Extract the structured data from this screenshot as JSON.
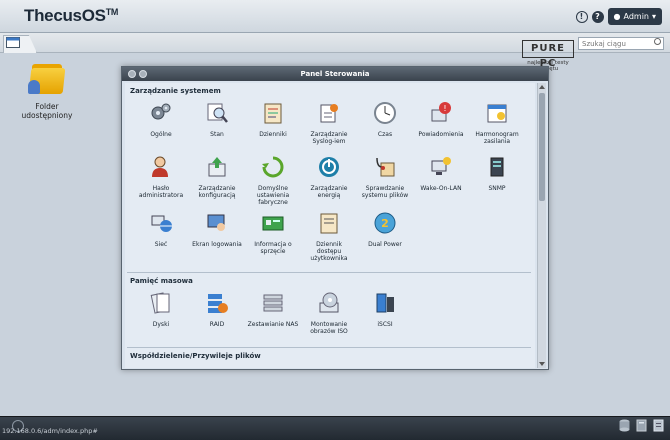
{
  "header": {
    "logo_main": "ThecusOS",
    "logo_tm": "TM",
    "info_icon": "info-icon",
    "help_icon": "help-icon",
    "user_label": "Admin"
  },
  "subbar": {
    "search_placeholder": "Szukaj ciągu"
  },
  "watermark": {
    "logo": "PURE PC",
    "tagline": "najlepsze testy sprzętu"
  },
  "desktop": {
    "folder_label": "Folder udostępniony"
  },
  "panel": {
    "title": "Panel Sterowania",
    "sections": [
      {
        "name": "Zarządzanie systemem",
        "items": [
          {
            "label": "Ogólne",
            "icon": "gears-icon"
          },
          {
            "label": "Stan",
            "icon": "magnifier-icon"
          },
          {
            "label": "Dzienniki",
            "icon": "log-icon"
          },
          {
            "label": "Zarządzanie Syslog-iem",
            "icon": "syslog-icon"
          },
          {
            "label": "Czas",
            "icon": "clock-icon"
          },
          {
            "label": "Powiadomienia",
            "icon": "notification-icon"
          },
          {
            "label": "Harmonogram zasilania",
            "icon": "schedule-icon"
          },
          {
            "label": "Hasło administratora",
            "icon": "admin-icon"
          },
          {
            "label": "Zarządzanie konfiguracją",
            "icon": "config-icon"
          },
          {
            "label": "Domyślne ustawienia fabryczne",
            "icon": "reset-icon"
          },
          {
            "label": "Zarządzanie energią",
            "icon": "power-icon"
          },
          {
            "label": "Sprawdzanie systemu plików",
            "icon": "stethoscope-icon"
          },
          {
            "label": "Wake-On-LAN",
            "icon": "wol-icon"
          },
          {
            "label": "SNMP",
            "icon": "snmp-icon"
          },
          {
            "label": "Sieć",
            "icon": "network-icon"
          },
          {
            "label": "Ekran logowania",
            "icon": "login-screen-icon"
          },
          {
            "label": "Informacja o sprzęcie",
            "icon": "hardware-info-icon"
          },
          {
            "label": "Dziennik dostępu użytkownika",
            "icon": "access-log-icon"
          },
          {
            "label": "Dual Power",
            "icon": "dual-power-icon"
          }
        ]
      },
      {
        "name": "Pamięć masowa",
        "items": [
          {
            "label": "Dyski",
            "icon": "disks-icon"
          },
          {
            "label": "RAID",
            "icon": "raid-icon"
          },
          {
            "label": "Zestawianie NAS",
            "icon": "nas-stack-icon"
          },
          {
            "label": "Montowanie obrazów ISO",
            "icon": "iso-icon"
          },
          {
            "label": "iSCSI",
            "icon": "iscsi-icon"
          }
        ]
      },
      {
        "name": "Współdzielenie/Przywileje plików",
        "items": []
      }
    ]
  },
  "statusbar": {
    "url": "192.168.0.6/adm/index.php#"
  },
  "colors": {
    "accent_dark": "#2c3947",
    "panel_bg": "#e4ebf3"
  }
}
